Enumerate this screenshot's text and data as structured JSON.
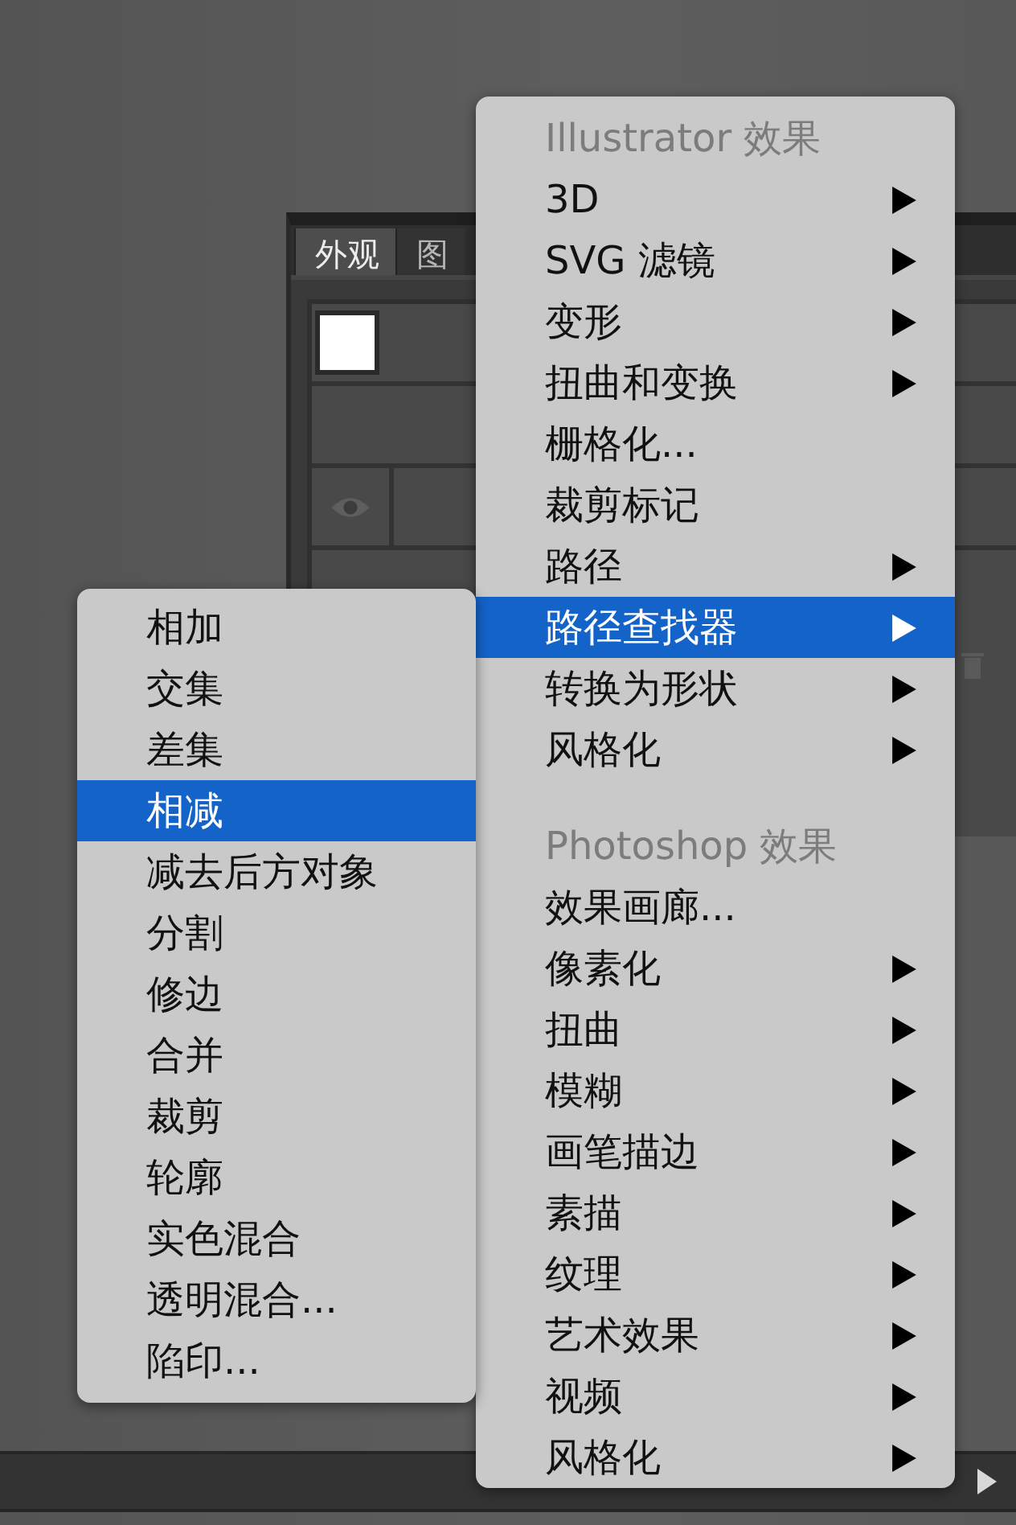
{
  "panel": {
    "tabs": [
      {
        "label": "外观",
        "selected": true
      },
      {
        "label": "图",
        "selected": false
      }
    ]
  },
  "effects_menu": {
    "items": [
      {
        "kind": "header",
        "label": "Illustrator 效果"
      },
      {
        "kind": "item",
        "label": "3D",
        "submenu": true,
        "selected": false
      },
      {
        "kind": "item",
        "label": "SVG 滤镜",
        "submenu": true,
        "selected": false
      },
      {
        "kind": "item",
        "label": "变形",
        "submenu": true,
        "selected": false
      },
      {
        "kind": "item",
        "label": "扭曲和变换",
        "submenu": true,
        "selected": false
      },
      {
        "kind": "item",
        "label": "栅格化...",
        "submenu": false,
        "selected": false
      },
      {
        "kind": "item",
        "label": "裁剪标记",
        "submenu": false,
        "selected": false
      },
      {
        "kind": "item",
        "label": "路径",
        "submenu": true,
        "selected": false
      },
      {
        "kind": "item",
        "label": "路径查找器",
        "submenu": true,
        "selected": true
      },
      {
        "kind": "item",
        "label": "转换为形状",
        "submenu": true,
        "selected": false
      },
      {
        "kind": "item",
        "label": "风格化",
        "submenu": true,
        "selected": false
      },
      {
        "kind": "separator"
      },
      {
        "kind": "header",
        "label": "Photoshop 效果"
      },
      {
        "kind": "item",
        "label": "效果画廊...",
        "submenu": false,
        "selected": false
      },
      {
        "kind": "item",
        "label": "像素化",
        "submenu": true,
        "selected": false
      },
      {
        "kind": "item",
        "label": "扭曲",
        "submenu": true,
        "selected": false
      },
      {
        "kind": "item",
        "label": "模糊",
        "submenu": true,
        "selected": false
      },
      {
        "kind": "item",
        "label": "画笔描边",
        "submenu": true,
        "selected": false
      },
      {
        "kind": "item",
        "label": "素描",
        "submenu": true,
        "selected": false
      },
      {
        "kind": "item",
        "label": "纹理",
        "submenu": true,
        "selected": false
      },
      {
        "kind": "item",
        "label": "艺术效果",
        "submenu": true,
        "selected": false
      },
      {
        "kind": "item",
        "label": "视频",
        "submenu": true,
        "selected": false
      },
      {
        "kind": "item",
        "label": "风格化",
        "submenu": true,
        "selected": false
      }
    ]
  },
  "pathfinder_submenu": {
    "items": [
      {
        "label": "相加",
        "selected": false
      },
      {
        "label": "交集",
        "selected": false
      },
      {
        "label": "差集",
        "selected": false
      },
      {
        "label": "相减",
        "selected": true
      },
      {
        "label": "减去后方对象",
        "selected": false
      },
      {
        "label": "分割",
        "selected": false
      },
      {
        "label": "修边",
        "selected": false
      },
      {
        "label": "合并",
        "selected": false
      },
      {
        "label": "裁剪",
        "selected": false
      },
      {
        "label": "轮廓",
        "selected": false
      },
      {
        "label": "实色混合",
        "selected": false
      },
      {
        "label": "透明混合...",
        "selected": false
      },
      {
        "label": "陷印...",
        "selected": false
      }
    ]
  }
}
